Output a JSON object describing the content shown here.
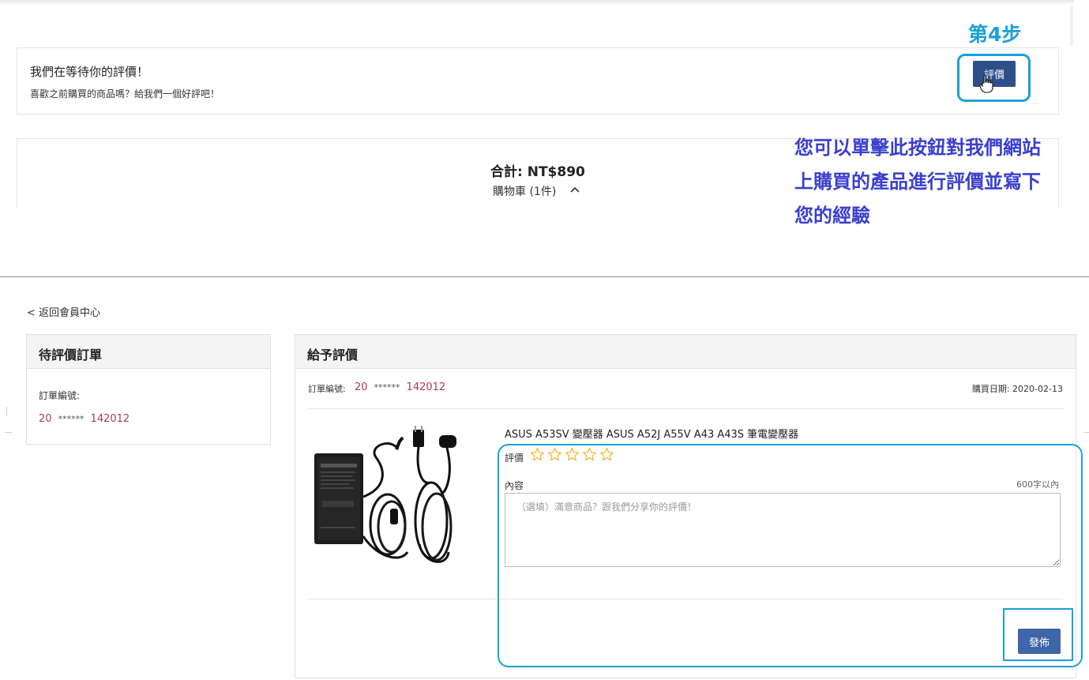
{
  "step_label": "第4步",
  "review_prompt": {
    "title": "我們在等待你的評價！",
    "subtitle": "喜歡之前購買的商品嗎？給我們一個好評吧！",
    "button_label": "評價"
  },
  "cart_summary": {
    "total": "合計: NT$890",
    "cart": "購物車 (1件)"
  },
  "annotation_lines": [
    "您可以單擊此按鈕對我們網站",
    "上購買的產品進行評價並寫下",
    "您的經驗"
  ],
  "back_link": "< 返回會員中心",
  "pending_panel": {
    "title": "待評價訂單",
    "order_label": "訂單編號:",
    "order_prefix": "20",
    "order_mask": "******",
    "order_suffix": "142012"
  },
  "review_panel": {
    "title": "給予評價",
    "order_label": "訂單編號:",
    "order_prefix": "20",
    "order_mask": "******",
    "order_suffix": "142012",
    "purchase_date": "購買日期: 2020-02-13",
    "product_name": "ASUS A53SV 變壓器 ASUS A52J A55V A43 A43S 筆電變壓器",
    "rating_label": "評價",
    "rating_value": 0,
    "rating_max": 5,
    "content_label": "內容",
    "char_limit": "600字以內",
    "content_placeholder": "（選填）滿意商品？跟我們分享你的評價！",
    "publish_label": "發佈"
  },
  "colors": {
    "highlight": "#1aa0d8",
    "annotation": "#3a3fcf",
    "button": "#2d4f8a",
    "order_number": "#b13a4e",
    "star": "#f0b429"
  }
}
